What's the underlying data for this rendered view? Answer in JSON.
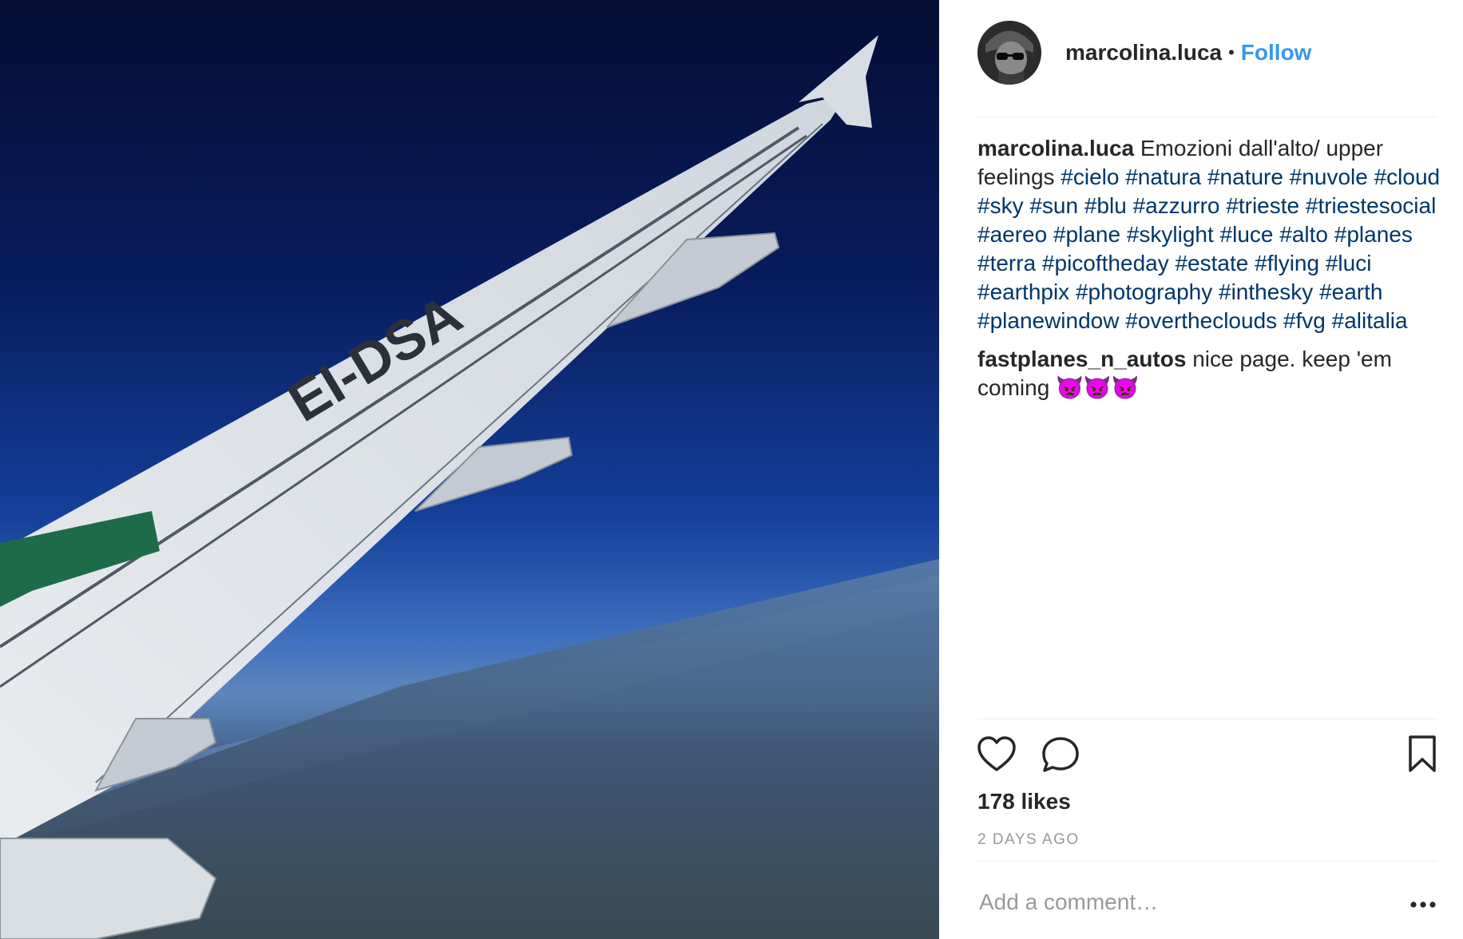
{
  "photo": {
    "wing_registration": "EI-DSA",
    "alt": "airplane-wing-over-clouds"
  },
  "header": {
    "username": "marcolina.luca",
    "separator": "•",
    "follow_label": "Follow"
  },
  "caption": {
    "username": "marcolina.luca",
    "text": "Emozioni dall'alto/ upper feelings",
    "hashtags": "#cielo #natura #nature #nuvole #cloud #sky #sun #blu #azzurro #trieste #triestesocial #aereo #plane #skylight #luce #alto #planes #terra #picoftheday #estate #flying #luci #earthpix #photography #inthesky #earth #planewindow #overtheclouds #fvg #alitalia"
  },
  "comment": {
    "username": "fastplanes_n_autos",
    "text": "nice page. keep 'em coming",
    "emoji": "👿👿👿"
  },
  "actions": {
    "like_icon": "heart-icon",
    "comment_icon": "comment-bubble-icon",
    "save_icon": "bookmark-icon"
  },
  "likes": "178 likes",
  "timestamp": "2 DAYS AGO",
  "add_comment": {
    "placeholder": "Add a comment…",
    "more_icon": "ellipsis-icon"
  },
  "colors": {
    "link": "#3897f0",
    "hashtag": "#003569",
    "muted": "#999999",
    "text": "#262626"
  }
}
